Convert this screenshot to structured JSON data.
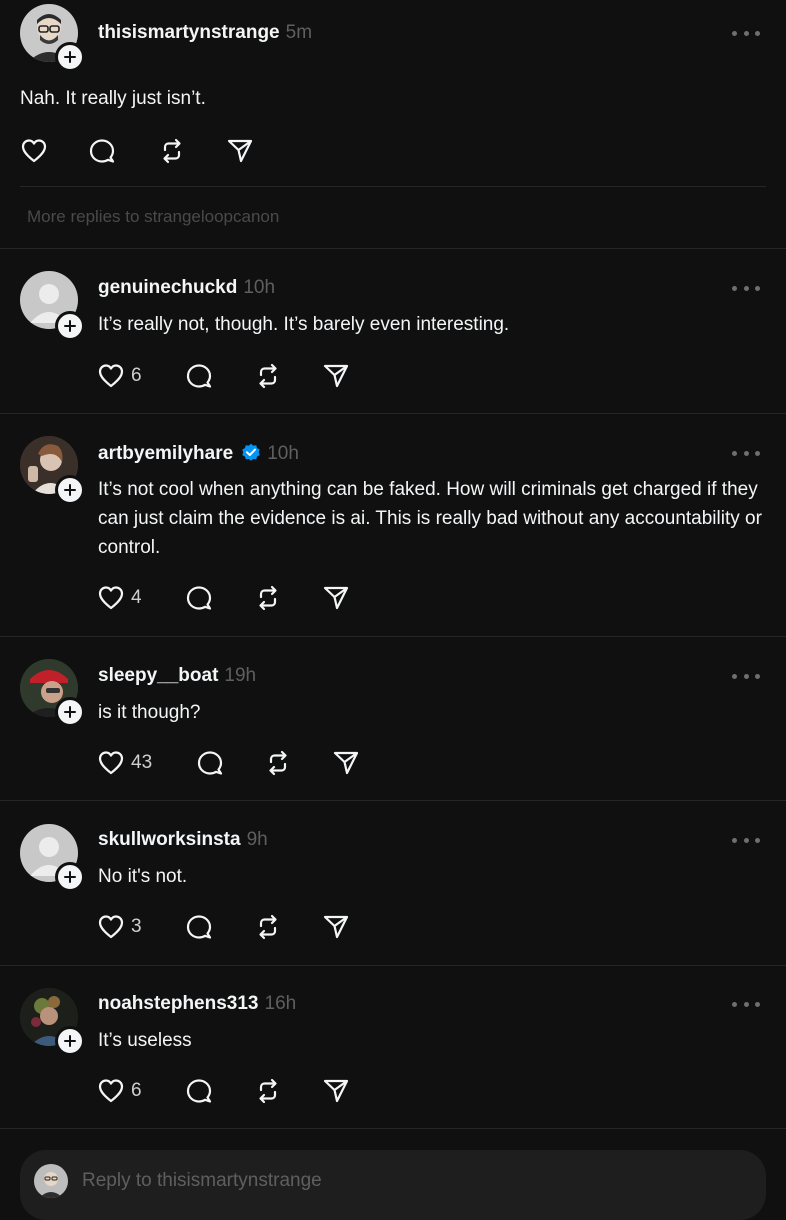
{
  "main_post": {
    "username": "thisismartynstrange",
    "time": "5m",
    "text": "Nah. It really just isn’t."
  },
  "more_replies_text": "More replies to strangeloopcanon",
  "replies": [
    {
      "username": "genuinechuckd",
      "time": "10h",
      "verified": false,
      "text": "It’s really not, though. It’s barely even interesting.",
      "likes": "6"
    },
    {
      "username": "artbyemilyhare",
      "time": "10h",
      "verified": true,
      "text": "It’s not cool when anything can be faked. How will criminals get charged if they can just claim the evidence is ai. This is really bad without any accountability or control.",
      "likes": "4"
    },
    {
      "username": "sleepy__boat",
      "time": "19h",
      "verified": false,
      "text": "is it though?",
      "likes": "43"
    },
    {
      "username": "skullworksinsta",
      "time": "9h",
      "verified": false,
      "text": "No it's not.",
      "likes": "3"
    },
    {
      "username": "noahstephens313",
      "time": "16h",
      "verified": false,
      "text": "It’s useless",
      "likes": "6"
    }
  ],
  "reply_bar": {
    "placeholder": "Reply to thisismartynstrange"
  },
  "icons": {
    "like": "heart-icon",
    "comment": "comment-bubble-icon",
    "repost": "repost-icon",
    "share": "send-icon",
    "more": "more-options-icon",
    "follow": "plus-icon",
    "verified": "verified-badge-icon"
  },
  "colors": {
    "background": "#101010",
    "text": "#f3f5f7",
    "muted": "#5f5f5f",
    "verified": "#0095f6"
  }
}
